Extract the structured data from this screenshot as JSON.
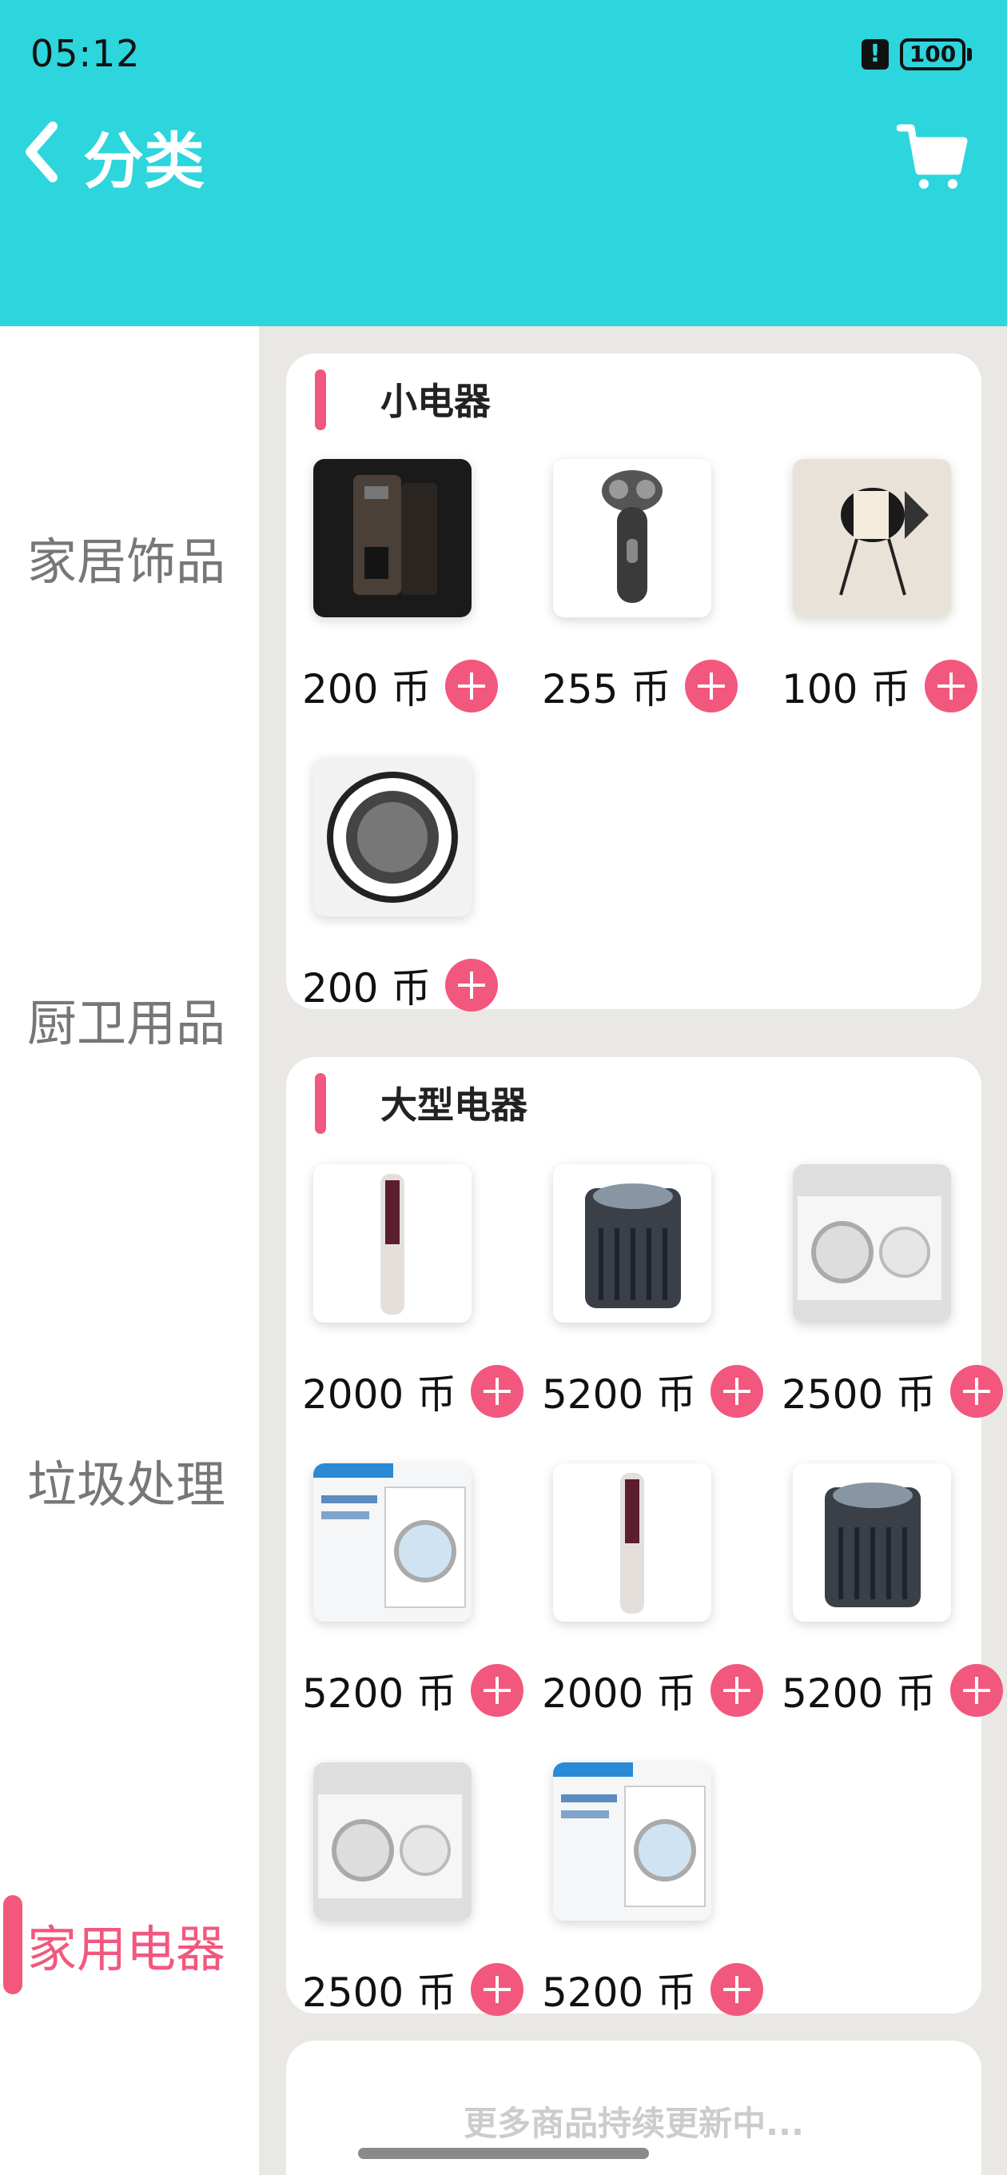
{
  "status": {
    "time": "05:12",
    "battery": "100"
  },
  "header": {
    "title": "分类",
    "back_icon": "chevron-left-icon",
    "cart_icon": "cart-icon"
  },
  "colors": {
    "header_bg": "#2dd5dc",
    "accent": "#f2577d"
  },
  "sidebar": {
    "items": [
      {
        "label": "家居饰品",
        "active": false
      },
      {
        "label": "厨卫用品",
        "active": false
      },
      {
        "label": "垃圾处理",
        "active": false
      },
      {
        "label": "家用电器",
        "active": true
      }
    ]
  },
  "sections": [
    {
      "title": "小电器",
      "products": [
        {
          "price": "200 币",
          "image": "water-dispenser"
        },
        {
          "price": "255 币",
          "image": "electric-shaver"
        },
        {
          "price": "100 币",
          "image": "desk-fan"
        },
        {
          "price": "200 币",
          "image": "round-speaker"
        }
      ]
    },
    {
      "title": "大型电器",
      "products": [
        {
          "price": "2000 币",
          "image": "tower-air-conditioner"
        },
        {
          "price": "5200 币",
          "image": "air-purifier"
        },
        {
          "price": "2500 币",
          "image": "washer-dryer"
        },
        {
          "price": "5200 币",
          "image": "washing-machine"
        },
        {
          "price": "2000 币",
          "image": "tower-air-conditioner"
        },
        {
          "price": "5200 币",
          "image": "air-purifier"
        },
        {
          "price": "2500 币",
          "image": "washer-dryer"
        },
        {
          "price": "5200 币",
          "image": "washing-machine"
        }
      ]
    }
  ],
  "footer": {
    "more_text": "更多商品持续更新中..."
  }
}
